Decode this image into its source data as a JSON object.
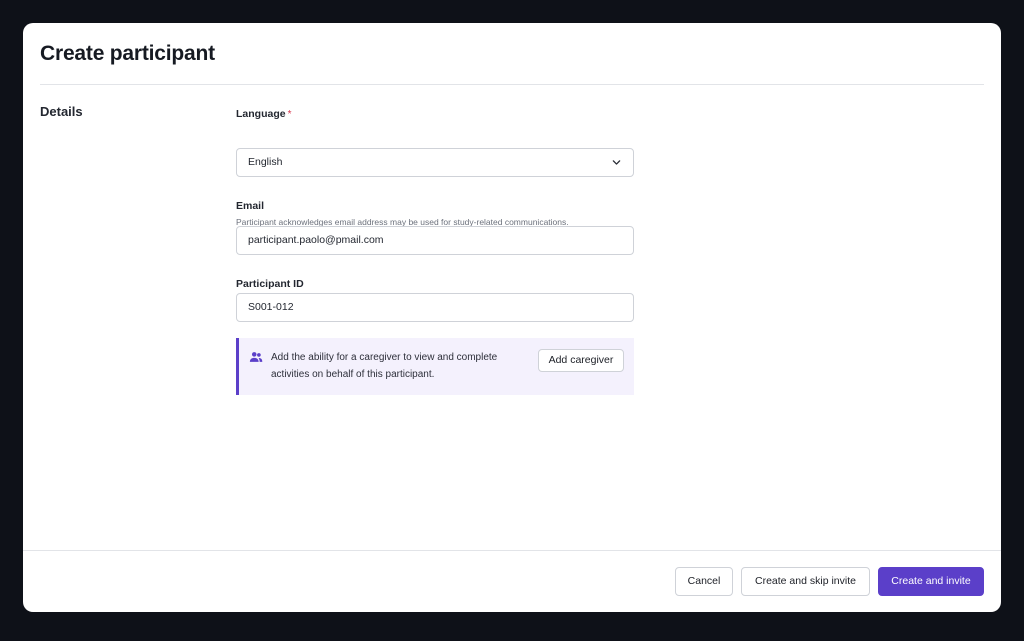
{
  "modal": {
    "title": "Create participant",
    "section_label": "Details"
  },
  "form": {
    "language": {
      "label": "Language",
      "required_mark": "*",
      "value": "English"
    },
    "email": {
      "label": "Email",
      "help": "Participant acknowledges email address may be used for study-related communications.",
      "value": "participant.paolo@pmail.com"
    },
    "participant_id": {
      "label": "Participant ID",
      "value": "S001-012"
    },
    "caregiver_callout": {
      "icon": "users-icon",
      "text": "Add the ability for a caregiver to view and complete activities on behalf of this participant.",
      "button_label": "Add caregiver"
    }
  },
  "footer": {
    "cancel_label": "Cancel",
    "skip_label": "Create and skip invite",
    "primary_label": "Create and invite"
  },
  "colors": {
    "accent": "#5b3fc9",
    "callout_bg": "#f4f1fd",
    "required": "#d6334a",
    "backdrop": "#0e1118"
  }
}
